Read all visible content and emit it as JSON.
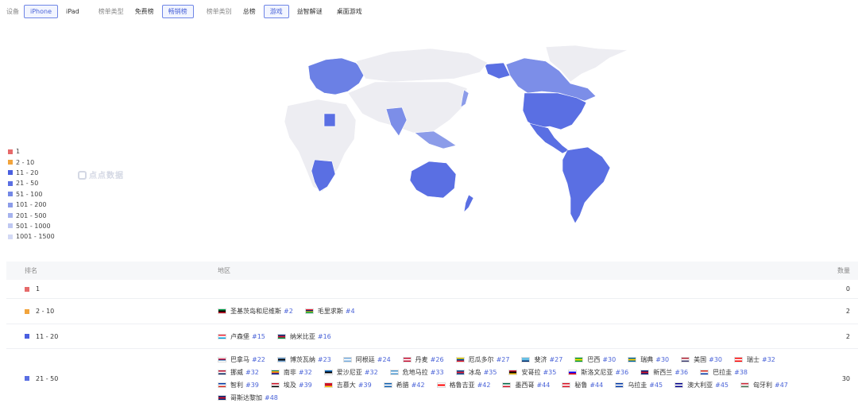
{
  "filters": {
    "device": {
      "label": "设备",
      "options": [
        "iPhone",
        "iPad"
      ],
      "active": 0
    },
    "chart_type": {
      "label": "榜单类型",
      "options": [
        "免费榜",
        "畅销榜"
      ],
      "active": 1
    },
    "category": {
      "label": "榜单类别",
      "options": [
        "总榜",
        "游戏",
        "益智解谜",
        "桌面游戏"
      ],
      "active": 1
    }
  },
  "watermark": "点点数据",
  "legend": [
    {
      "label": "1",
      "color": "#e66a6a"
    },
    {
      "label": "2 - 10",
      "color": "#f2a43c"
    },
    {
      "label": "11 - 20",
      "color": "#4a5fe0"
    },
    {
      "label": "21 - 50",
      "color": "#5a6fe3"
    },
    {
      "label": "51 - 100",
      "color": "#7488e6"
    },
    {
      "label": "101 - 200",
      "color": "#8c9ce9"
    },
    {
      "label": "201 - 500",
      "color": "#a6b3ee"
    },
    {
      "label": "501 - 1000",
      "color": "#bfc8f2"
    },
    {
      "label": "1001 - 1500",
      "color": "#d3d9f5"
    }
  ],
  "table": {
    "headers": {
      "rank": "排名",
      "region": "地区",
      "count": "数量"
    },
    "rows": [
      {
        "rank": "1",
        "color": "#e66a6a",
        "count": "0",
        "countries": []
      },
      {
        "rank": "2 - 10",
        "color": "#f2a43c",
        "count": "2",
        "countries": [
          {
            "name": "圣基茨岛和尼维斯",
            "rank": "#2",
            "flag": [
              "#009e49",
              "#000000",
              "#ce1126"
            ]
          },
          {
            "name": "毛里求斯",
            "rank": "#4",
            "flag": [
              "#ea2839",
              "#1a206d",
              "#ffd500",
              "#00a551"
            ]
          }
        ]
      },
      {
        "rank": "11 - 20",
        "color": "#4a5fe0",
        "count": "2",
        "countries": [
          {
            "name": "卢森堡",
            "rank": "#15",
            "flag": [
              "#ed2939",
              "#ffffff",
              "#00a1de"
            ]
          },
          {
            "name": "纳米比亚",
            "rank": "#16",
            "flag": [
              "#003580",
              "#d21034",
              "#009543"
            ]
          }
        ]
      },
      {
        "rank": "21 - 50",
        "color": "#5a6fe3",
        "count": "30",
        "countries": [
          {
            "name": "巴拿马",
            "rank": "#22",
            "flag": [
              "#ffffff",
              "#d21034",
              "#005aa7",
              "#ffffff"
            ]
          },
          {
            "name": "博茨瓦纳",
            "rank": "#23",
            "flag": [
              "#75aadb",
              "#000000",
              "#75aadb"
            ]
          },
          {
            "name": "阿根廷",
            "rank": "#24",
            "flag": [
              "#74acdf",
              "#ffffff",
              "#74acdf"
            ]
          },
          {
            "name": "丹麦",
            "rank": "#26",
            "flag": [
              "#c60c30",
              "#ffffff",
              "#c60c30"
            ]
          },
          {
            "name": "厄瓜多尔",
            "rank": "#27",
            "flag": [
              "#ffdd00",
              "#034ea2",
              "#ed1c24"
            ]
          },
          {
            "name": "斐济",
            "rank": "#27",
            "flag": [
              "#68bfe5",
              "#68bfe5",
              "#002868"
            ]
          },
          {
            "name": "巴西",
            "rank": "#30",
            "flag": [
              "#009c3b",
              "#ffdf00",
              "#009c3b"
            ]
          },
          {
            "name": "瑞典",
            "rank": "#30",
            "flag": [
              "#006aa7",
              "#fecc00",
              "#006aa7"
            ]
          },
          {
            "name": "美国",
            "rank": "#30",
            "flag": [
              "#b22234",
              "#ffffff",
              "#3c3b6e"
            ]
          },
          {
            "name": "瑞士",
            "rank": "#32",
            "flag": [
              "#ff0000",
              "#ffffff",
              "#ff0000"
            ]
          },
          {
            "name": "挪威",
            "rank": "#32",
            "flag": [
              "#ba0c2f",
              "#ffffff",
              "#00205b"
            ]
          },
          {
            "name": "南非",
            "rank": "#32",
            "flag": [
              "#007a4d",
              "#ffb612",
              "#de3831",
              "#002395"
            ]
          },
          {
            "name": "爱沙尼亚",
            "rank": "#32",
            "flag": [
              "#0072ce",
              "#000000",
              "#ffffff"
            ]
          },
          {
            "name": "危地马拉",
            "rank": "#33",
            "flag": [
              "#4997d0",
              "#ffffff",
              "#4997d0"
            ]
          },
          {
            "name": "冰岛",
            "rank": "#35",
            "flag": [
              "#02529c",
              "#dc1e35",
              "#02529c"
            ]
          },
          {
            "name": "安哥拉",
            "rank": "#35",
            "flag": [
              "#cc092f",
              "#000000",
              "#ffcb00"
            ]
          },
          {
            "name": "斯洛文尼亚",
            "rank": "#36",
            "flag": [
              "#ffffff",
              "#0000ff",
              "#ff0000"
            ]
          },
          {
            "name": "新西兰",
            "rank": "#36",
            "flag": [
              "#00247d",
              "#cc142b",
              "#00247d"
            ]
          },
          {
            "name": "巴拉圭",
            "rank": "#38",
            "flag": [
              "#d52b1e",
              "#ffffff",
              "#0038a8"
            ]
          },
          {
            "name": "智利",
            "rank": "#39",
            "flag": [
              "#0039a6",
              "#ffffff",
              "#d52b1e"
            ]
          },
          {
            "name": "埃及",
            "rank": "#39",
            "flag": [
              "#ce1126",
              "#ffffff",
              "#000000"
            ]
          },
          {
            "name": "吉慕大",
            "rank": "#39",
            "flag": [
              "#ce1126",
              "#ce1126",
              "#fcd116"
            ]
          },
          {
            "name": "希腊",
            "rank": "#42",
            "flag": [
              "#0d5eaf",
              "#ffffff",
              "#0d5eaf"
            ]
          },
          {
            "name": "格鲁吉亚",
            "rank": "#42",
            "flag": [
              "#ffffff",
              "#ff0000",
              "#ffffff"
            ]
          },
          {
            "name": "墨西哥",
            "rank": "#44",
            "flag": [
              "#006847",
              "#ffffff",
              "#ce1126"
            ]
          },
          {
            "name": "秘鲁",
            "rank": "#44",
            "flag": [
              "#d91023",
              "#ffffff",
              "#d91023"
            ]
          },
          {
            "name": "乌拉圭",
            "rank": "#45",
            "flag": [
              "#0038a8",
              "#ffffff",
              "#0038a8"
            ]
          },
          {
            "name": "澳大利亚",
            "rank": "#45",
            "flag": [
              "#00008b",
              "#ffffff",
              "#00008b"
            ]
          },
          {
            "name": "匈牙利",
            "rank": "#47",
            "flag": [
              "#ce2939",
              "#ffffff",
              "#477050"
            ]
          },
          {
            "name": "哥斯达黎加",
            "rank": "#48",
            "flag": [
              "#002b7f",
              "#ce1126",
              "#002b7f"
            ]
          }
        ]
      }
    ]
  }
}
